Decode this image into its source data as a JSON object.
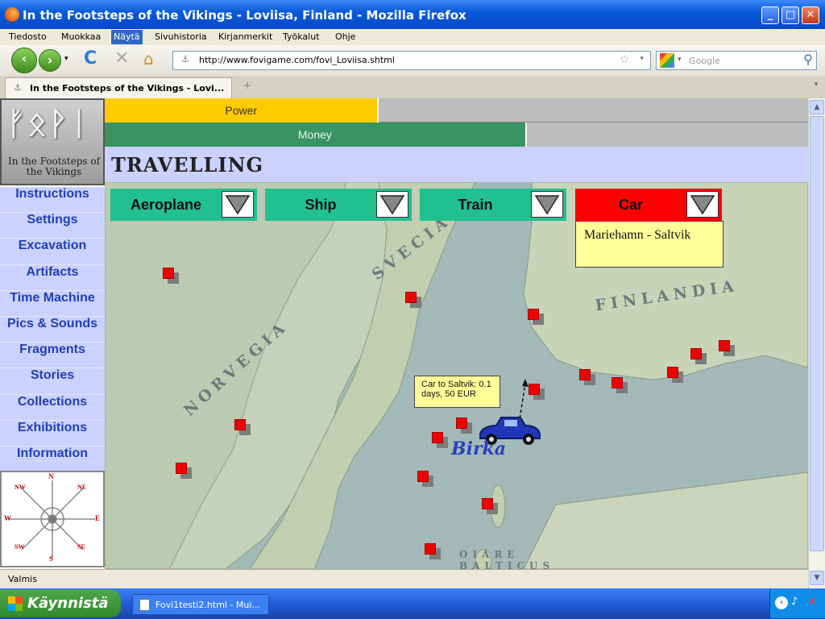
{
  "window": {
    "title": "In the Footsteps of the Vikings - Loviisa, Finland - Mozilla Firefox"
  },
  "menubar": [
    "Tiedosto",
    "Muokkaa",
    "Näytä",
    "Sivuhistoria",
    "Kirjanmerkit",
    "Työkalut",
    "Ohje"
  ],
  "menubar_active": "Näytä",
  "address": {
    "url": "http://www.fovigame.com/fovi_Loviisa.shtml"
  },
  "search": {
    "placeholder": "Google"
  },
  "tab": {
    "label": "In the Footsteps of the Vikings - Lovi..."
  },
  "status": {
    "text": "Valmis"
  },
  "taskbar": {
    "start": "Käynnistä",
    "item": "Fovi1testi2.html - Mui..."
  },
  "logo": {
    "runes": "ᚠᛟᚹᛁ",
    "tagline": "In the Footsteps of the Vikings"
  },
  "menu": [
    "Instructions",
    "Settings",
    "Excavation",
    "Artifacts",
    "Time Machine",
    "Pics & Sounds",
    "Fragments",
    "Stories",
    "Collections",
    "Exhibitions",
    "Information"
  ],
  "compass": {
    "n": "N",
    "s": "S",
    "e": "E",
    "w": "W",
    "nw": "NW",
    "ne": "NE",
    "sw": "SW",
    "se": "SE"
  },
  "bars": {
    "power": "Power",
    "power_level": 0.39,
    "money": "Money",
    "money_level": 0.6
  },
  "page": {
    "title": "TRAVELLING"
  },
  "transport": [
    {
      "label": "Aeroplane",
      "active": false
    },
    {
      "label": "Ship",
      "active": false
    },
    {
      "label": "Train",
      "active": false
    },
    {
      "label": "Car",
      "active": true
    }
  ],
  "car_route": "Mariehamn - Saltvik",
  "tooltip": "Car to Saltvik: 0.1 days, 50 EUR",
  "map": {
    "labels": [
      "SVECIA",
      "FINLANDIA",
      "NORVEGIA",
      "OIARE BALTICUS"
    ],
    "current_place": "Birka"
  },
  "colors": {
    "power": "#ffcc00",
    "money": "#3a9462",
    "transport": "#20c08f",
    "active_transport": "#ff0000",
    "marker": "#ee0000",
    "menu": "#1f3fb9"
  }
}
